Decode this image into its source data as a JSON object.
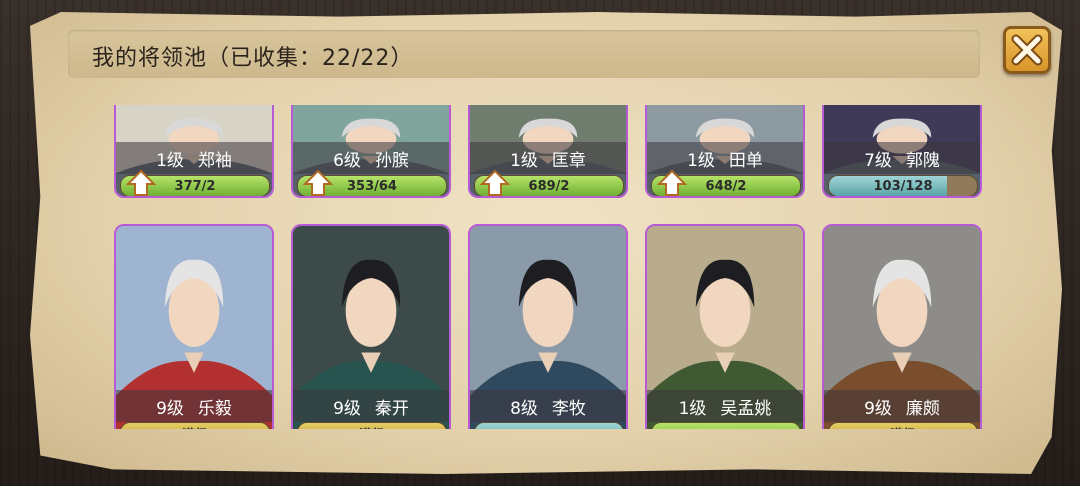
{
  "title": "我的将领池（已收集：22/22）",
  "top_row": [
    {
      "level": "1级",
      "name": "郑袖",
      "progress": "377/2",
      "fill": 1.0,
      "upgrade": true,
      "bg": "#d8d3c7"
    },
    {
      "level": "6级",
      "name": "孙膑",
      "progress": "353/64",
      "fill": 1.0,
      "upgrade": true,
      "bg": "#7fa59d"
    },
    {
      "level": "1级",
      "name": "匡章",
      "progress": "689/2",
      "fill": 1.0,
      "upgrade": true,
      "bg": "#6f7d6e"
    },
    {
      "level": "1级",
      "name": "田单",
      "progress": "648/2",
      "fill": 1.0,
      "upgrade": true,
      "bg": "#8e9aa2"
    },
    {
      "level": "7级",
      "name": "郭隗",
      "progress": "103/128",
      "fill": 0.8,
      "upgrade": false,
      "bg": "#3f3a58"
    }
  ],
  "bottom_row": [
    {
      "level": "9级",
      "name": "乐毅",
      "status": "满级",
      "bg": "#9fb4d0",
      "robe": "#b23030"
    },
    {
      "level": "9级",
      "name": "秦开",
      "status": "满级",
      "bg": "#3d4a4a",
      "robe": "#27544e"
    },
    {
      "level": "8级",
      "name": "李牧",
      "status": "",
      "bg": "#8a9aa8",
      "robe": "#2f4a5e"
    },
    {
      "level": "1级",
      "name": "吴孟姚",
      "status": "",
      "bg": "#b9ac8c",
      "robe": "#3f5a32"
    },
    {
      "level": "9级",
      "name": "廉颇",
      "status": "满级",
      "bg": "#8d8c88",
      "robe": "#7a4e2c"
    }
  ]
}
